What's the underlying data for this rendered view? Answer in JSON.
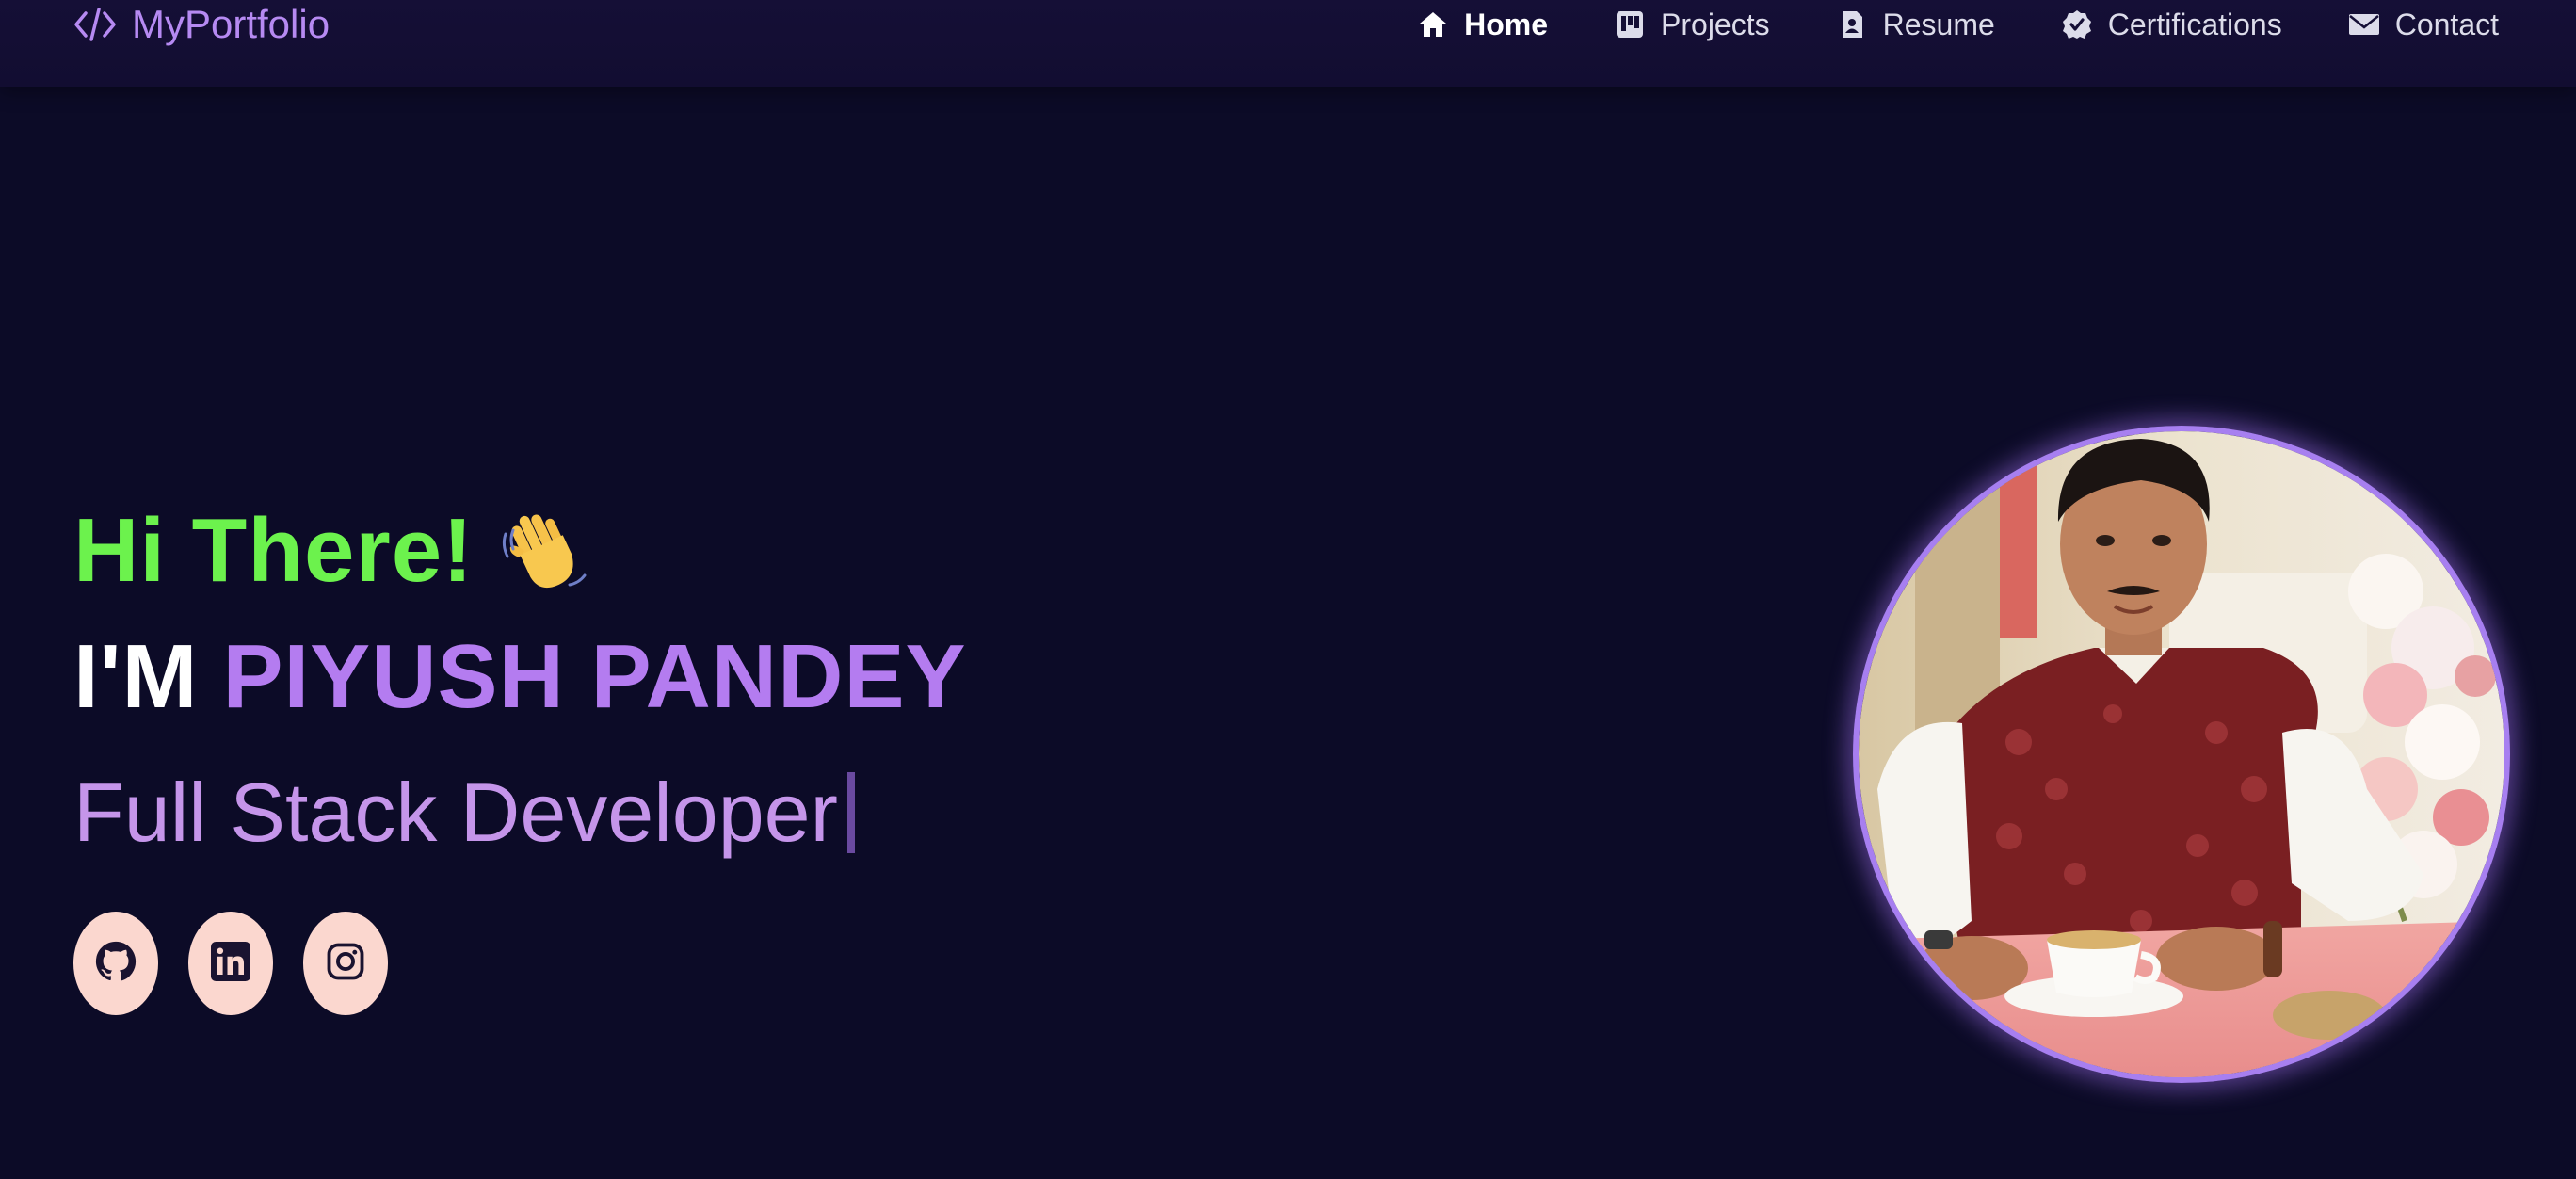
{
  "brand": {
    "label": "MyPortfolio",
    "icon": "code-icon",
    "color": "#b68af2"
  },
  "nav": {
    "items": [
      {
        "label": "Home",
        "icon": "home-icon",
        "active": true
      },
      {
        "label": "Projects",
        "icon": "kanban-icon",
        "active": false
      },
      {
        "label": "Resume",
        "icon": "document-icon",
        "active": false
      },
      {
        "label": "Certifications",
        "icon": "badge-check-icon",
        "active": false
      },
      {
        "label": "Contact",
        "icon": "envelope-icon",
        "active": false
      }
    ]
  },
  "hero": {
    "greeting": "Hi There!",
    "greeting_emoji": "waving-hand-icon",
    "intro_prefix": "I'M",
    "name": "PIYUSH PANDEY",
    "role": "Full Stack Developer",
    "socials": [
      {
        "icon": "github-icon"
      },
      {
        "icon": "linkedin-icon"
      },
      {
        "icon": "instagram-icon"
      }
    ]
  },
  "avatar": {
    "icon": "profile-photo"
  },
  "colors": {
    "background": "#0c0b27",
    "navbar": "#150f36",
    "greeting": "#6cf24d",
    "accent": "#b47cf0",
    "role": "#c595ea",
    "social_bg": "#fbd7cf",
    "avatar_ring": "#a77ff0"
  }
}
